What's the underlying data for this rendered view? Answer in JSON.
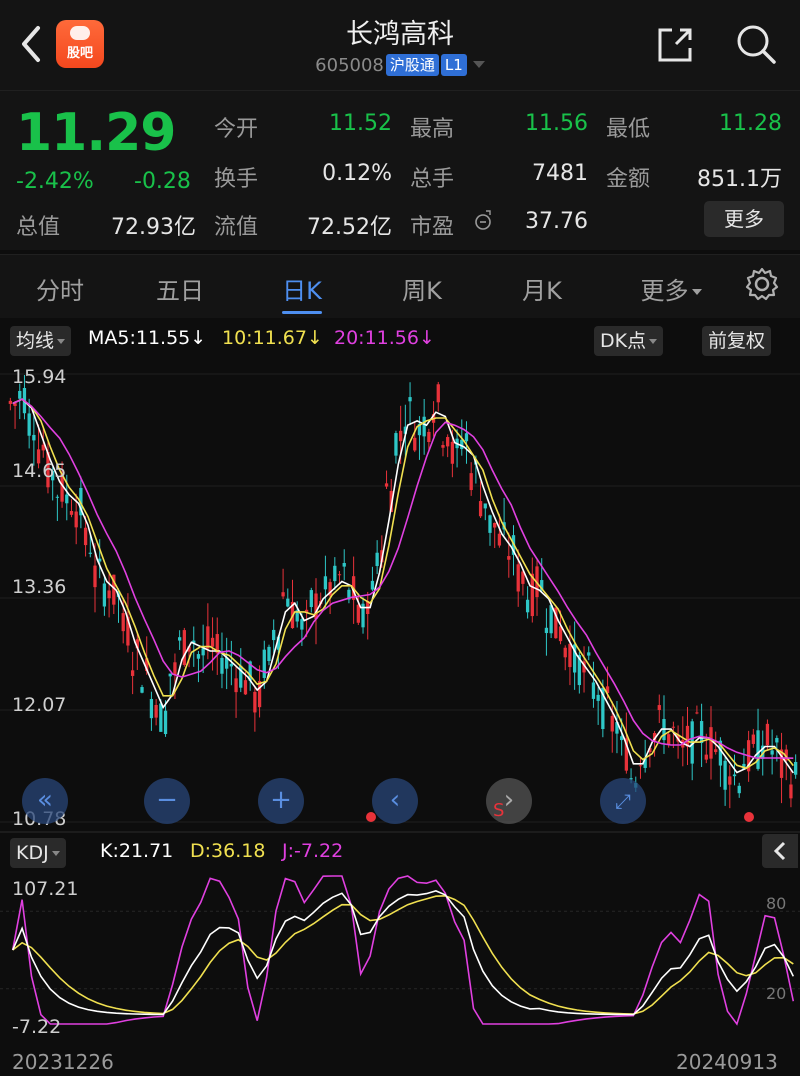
{
  "header": {
    "stock_name": "长鸿高科",
    "stock_code": "605008",
    "market_badge": "沪股通",
    "level_badge": "L1",
    "guba_label": "股吧",
    "icons": [
      "back-icon",
      "share-icon",
      "search-icon"
    ]
  },
  "quote": {
    "price": "11.29",
    "change_pct": "-2.42%",
    "change": "-0.28",
    "fields": {
      "open_label": "今开",
      "open": "11.52",
      "high_label": "最高",
      "high": "11.56",
      "low_label": "最低",
      "low": "11.28",
      "turnover_label": "换手",
      "turnover": "0.12%",
      "volume_label": "总手",
      "volume": "7481",
      "amount_label": "金额",
      "amount": "851.1万",
      "mcap_label": "总值",
      "mcap": "72.93亿",
      "float_label": "流值",
      "float": "72.52亿",
      "pe_label": "市盈",
      "pe": "37.76"
    },
    "more_label": "更多"
  },
  "tabs": [
    {
      "label": "分时"
    },
    {
      "label": "五日"
    },
    {
      "label": "日K",
      "active": true
    },
    {
      "label": "周K"
    },
    {
      "label": "月K"
    },
    {
      "label": "更多"
    }
  ],
  "ma": {
    "selector": "均线",
    "ma5": "MA5:11.55↓",
    "ma10": "10:11.67↓",
    "ma20": "20:11.56↓",
    "dk_label": "DK点",
    "adjust_label": "前复权"
  },
  "colors": {
    "up": "#e8323a",
    "down": "#2ec7c7",
    "ma5": "#ffffff",
    "ma10": "#f0e050",
    "ma20": "#e040e0",
    "accent": "#4e8ff0",
    "green": "#19c14a"
  },
  "price_axis": {
    "labels": [
      "15.94",
      "14.65",
      "13.36",
      "12.07",
      "10.78"
    ]
  },
  "kdj": {
    "selector": "KDJ",
    "k": "K:21.71",
    "d": "D:36.18",
    "j": "J:-7.22",
    "axis_top": "107.21",
    "axis_bottom": "-7.22",
    "ref_high": "80",
    "ref_low": "20"
  },
  "dates": {
    "start": "20231226",
    "end": "20240913"
  },
  "chart_data": {
    "type": "candlestick",
    "y_range": [
      10.78,
      15.94
    ],
    "close_path": [
      15.6,
      15.7,
      15.4,
      15.1,
      14.8,
      14.6,
      14.5,
      14.4,
      14.0,
      13.6,
      13.5,
      13.4,
      13.0,
      12.7,
      12.5,
      12.2,
      12.0,
      12.5,
      12.8,
      12.9,
      12.7,
      12.8,
      12.7,
      12.6,
      12.5,
      12.4,
      12.2,
      12.6,
      13.0,
      13.4,
      13.2,
      13.0,
      13.3,
      13.4,
      13.5,
      13.6,
      13.4,
      13.1,
      13.4,
      13.9,
      14.6,
      15.2,
      15.5,
      15.3,
      15.4,
      15.6,
      15.3,
      15.0,
      15.2,
      14.8,
      14.5,
      14.2,
      14.0,
      13.9,
      13.6,
      13.4,
      13.5,
      13.2,
      13.0,
      12.8,
      12.6,
      12.5,
      12.3,
      12.1,
      11.9,
      11.6,
      11.3,
      11.6,
      11.8,
      11.9,
      11.8,
      11.6,
      11.7,
      11.8,
      11.7,
      11.6,
      11.4,
      11.3,
      11.5,
      11.6,
      11.7,
      11.6,
      11.4,
      11.29
    ],
    "ma5_end": 11.55,
    "ma10_end": 11.67,
    "ma20_end": 11.56,
    "kdj_end": {
      "k": 21.71,
      "d": 36.18,
      "j": -7.22
    }
  }
}
